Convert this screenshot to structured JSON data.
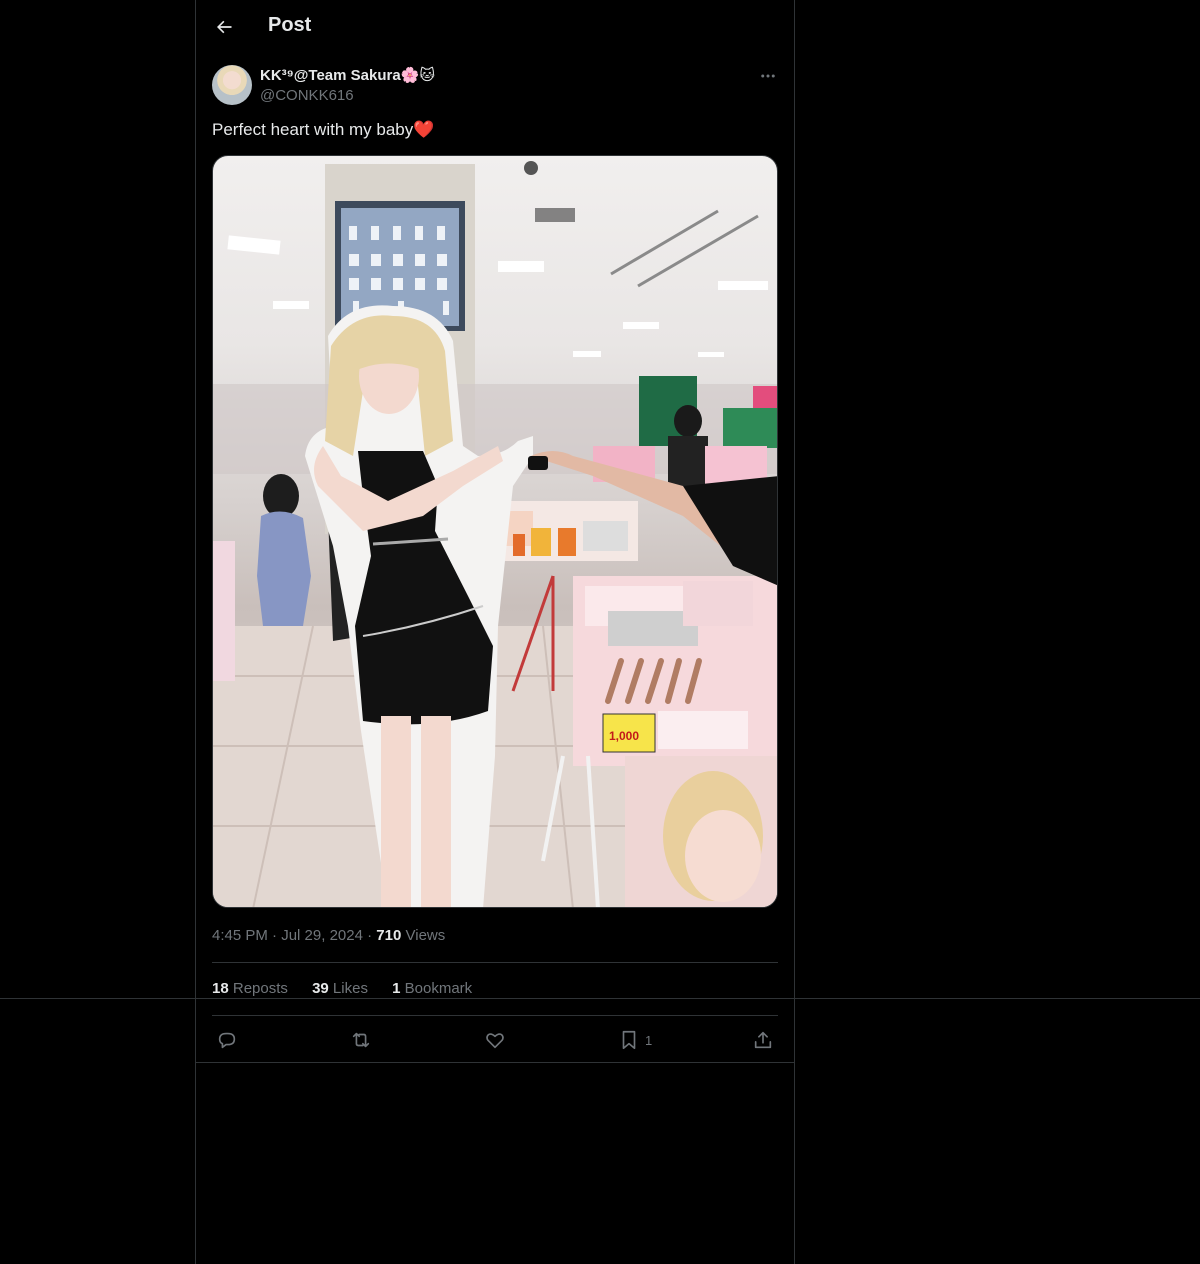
{
  "header": {
    "title": "Post"
  },
  "post": {
    "display_name": "KK³⁹@Team Sakura🌸🐱",
    "handle": "@CONKK616",
    "text": "Perfect heart with my baby❤️",
    "time": "4:45 PM",
    "date": "Jul 29, 2024",
    "views_count": "710",
    "views_label": "Views"
  },
  "stats": {
    "reposts_count": "18",
    "reposts_label": "Reposts",
    "likes_count": "39",
    "likes_label": "Likes",
    "bookmarks_count": "1",
    "bookmarks_label": "Bookmark"
  },
  "actions": {
    "bookmark_count": "1"
  },
  "media": {
    "price_tag": "1,000"
  },
  "icons": [
    "back-arrow-icon",
    "more-icon",
    "reply-icon",
    "repost-icon",
    "like-icon",
    "bookmark-icon",
    "share-icon"
  ],
  "colors": {
    "background": "#000000",
    "text": "#e7e9ea",
    "muted": "#71767b",
    "border": "#2f3336"
  }
}
